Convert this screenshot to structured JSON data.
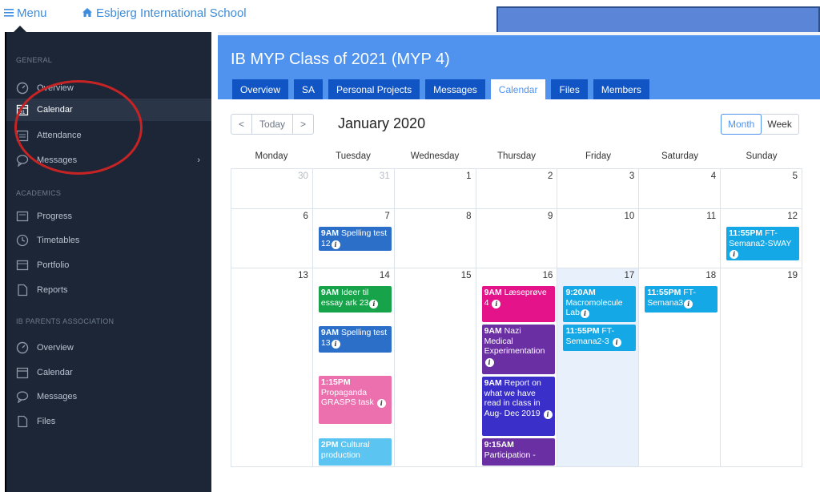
{
  "topbar": {
    "menu_label": "Menu",
    "school_name": "Esbjerg International School"
  },
  "sidebar": {
    "sections": [
      {
        "label": "GENERAL",
        "items": [
          {
            "label": "Overview",
            "icon": "overview-icon"
          },
          {
            "label": "Calendar",
            "icon": "calendar-icon",
            "active": true
          },
          {
            "label": "Attendance",
            "icon": "attendance-icon"
          },
          {
            "label": "Messages",
            "icon": "messages-icon",
            "has_submenu": true
          }
        ]
      },
      {
        "label": "ACADEMICS",
        "items": [
          {
            "label": "Progress",
            "icon": "progress-icon"
          },
          {
            "label": "Timetables",
            "icon": "clock-icon"
          },
          {
            "label": "Portfolio",
            "icon": "portfolio-icon"
          },
          {
            "label": "Reports",
            "icon": "reports-icon"
          }
        ]
      },
      {
        "label": "IB PARENTS ASSOCIATION",
        "items": [
          {
            "label": "Overview",
            "icon": "overview-icon"
          },
          {
            "label": "Calendar",
            "icon": "calendar-icon"
          },
          {
            "label": "Messages",
            "icon": "messages-icon"
          },
          {
            "label": "Files",
            "icon": "files-icon"
          }
        ]
      }
    ]
  },
  "header": {
    "title": "IB MYP Class of 2021 (MYP 4)",
    "tabs": [
      "Overview",
      "SA",
      "Personal Projects",
      "Messages",
      "Calendar",
      "Files",
      "Members"
    ],
    "active_tab": "Calendar"
  },
  "calendar": {
    "today_label": "Today",
    "prev_label": "<",
    "next_label": ">",
    "month_title": "January 2020",
    "view_month": "Month",
    "view_week": "Week",
    "days": [
      "Monday",
      "Tuesday",
      "Wednesday",
      "Thursday",
      "Friday",
      "Saturday",
      "Sunday"
    ],
    "weeks": [
      [
        "30",
        "31",
        "1",
        "2",
        "3",
        "4",
        "5"
      ],
      [
        "6",
        "7",
        "8",
        "9",
        "10",
        "11",
        "12"
      ],
      [
        "13",
        "14",
        "15",
        "16",
        "17",
        "18",
        "19"
      ]
    ],
    "events": {
      "e_w2_tue": {
        "time": "9AM",
        "title": "Spelling test 12",
        "color": "#2b6fc8"
      },
      "e_w2_sun": {
        "time": "11:55PM",
        "title": "FT-Semana2-SWAY",
        "color": "#15a8e6"
      },
      "e_w3_tue_1": {
        "time": "9AM",
        "title": "Ideer til essay ark 23",
        "color": "#17a34a"
      },
      "e_w3_tue_2": {
        "time": "9AM",
        "title": "Spelling test 13",
        "color": "#2b6fc8"
      },
      "e_w3_tue_3": {
        "time": "1:15PM",
        "title": "Propaganda GRASPS task",
        "color": "#ec6fae"
      },
      "e_w3_tue_4": {
        "time": "2PM",
        "title": "Cultural production",
        "color": "#5cc4f0"
      },
      "e_w3_thu_1": {
        "time": "9AM",
        "title": "Læseprøve 4",
        "color": "#e5138a"
      },
      "e_w3_thu_2": {
        "time": "9AM",
        "title": "Nazi Medical Experimentation",
        "color": "#6a2fa3"
      },
      "e_w3_thu_3": {
        "time": "9AM",
        "title": "Report on what we have read in class in Aug- Dec 2019",
        "color": "#3a2fc8"
      },
      "e_w3_thu_4": {
        "time": "9:15AM",
        "title": "Participation -",
        "color": "#6a2fa3"
      },
      "e_w3_fri_1": {
        "time": "9:20AM",
        "title": "Macromolecule Lab",
        "color": "#15a8e6"
      },
      "e_w3_fri_2": {
        "time": "11:55PM",
        "title": "FT-Semana2-3",
        "color": "#15a8e6"
      },
      "e_w3_sat_1": {
        "time": "11:55PM",
        "title": "FT-Semana3",
        "color": "#15a8e6"
      }
    }
  }
}
